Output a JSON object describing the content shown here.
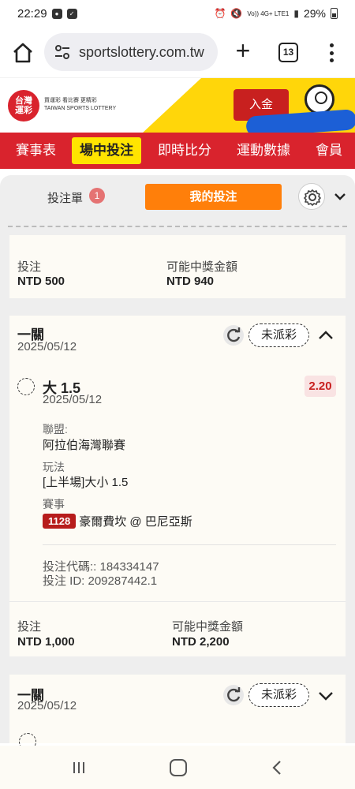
{
  "status_bar": {
    "time": "22:29",
    "signal_text": "Vo)) 4G+ LTE1",
    "battery": "29%"
  },
  "browser": {
    "url": "sportslottery.com.tw",
    "tab_count": "13"
  },
  "site": {
    "logo_text": "台灣運彩",
    "tagline": "TAIWAN SPORTS LOTTERY",
    "deposit_label": "入金"
  },
  "nav": {
    "items": [
      "賽事表",
      "場中投注",
      "即時比分",
      "運動數據",
      "會員"
    ]
  },
  "betslip": {
    "tab_label": "投注單",
    "badge_count": "1",
    "mybets_label": "我的投注"
  },
  "card1_footer": {
    "stake_label": "投注",
    "stake_value": "NTD 500",
    "payout_label": "可能中獎金額",
    "payout_value": "NTD 940"
  },
  "bet2": {
    "type": "一關",
    "date": "2025/05/12",
    "status": "未派彩",
    "selection": "大 1.5",
    "selection_date": "2025/05/12",
    "odds": "2.20",
    "league_label": "聯盟:",
    "league_value": "阿拉伯海灣聯賽",
    "market_label": "玩法",
    "market_value": "[上半場]大小 1.5",
    "event_label": "賽事",
    "match_id": "1128",
    "match_teams": "豪爾費坎 @ 巴尼亞斯",
    "bet_code": "投注代碼:: 184334147",
    "bet_id": "投注 ID: 209287442.1",
    "stake_label": "投注",
    "stake_value": "NTD 1,000",
    "payout_label": "可能中獎金額",
    "payout_value": "NTD 2,200"
  },
  "bet3": {
    "type": "一關",
    "date": "2025/05/12",
    "status": "未派彩"
  }
}
